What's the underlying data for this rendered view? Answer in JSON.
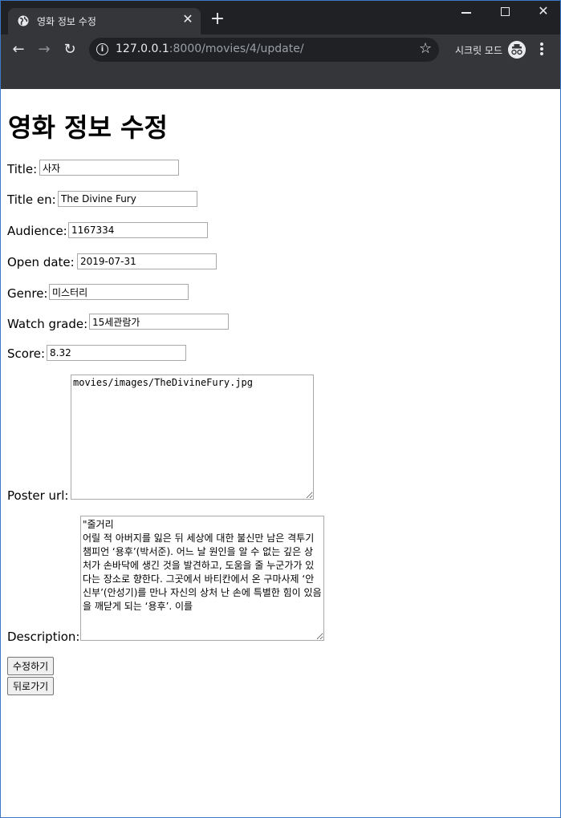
{
  "browser": {
    "tab_title": "영화 정보 수정",
    "url_host": "127.0.0.1",
    "url_rest": ":8000/movies/4/update/",
    "incognito_label": "시크릿 모드"
  },
  "page": {
    "heading": "영화 정보 수정",
    "fields": {
      "title": {
        "label": "Title:",
        "value": "사자"
      },
      "title_en": {
        "label": "Title en:",
        "value": "The Divine Fury"
      },
      "audience": {
        "label": "Audience:",
        "value": "1167334"
      },
      "open_date": {
        "label": "Open date:",
        "value": "2019-07-31"
      },
      "genre": {
        "label": "Genre:",
        "value": "미스터리"
      },
      "watch_grade": {
        "label": "Watch grade:",
        "value": "15세관람가"
      },
      "score": {
        "label": "Score:",
        "value": "8.32"
      },
      "poster_url": {
        "label": "Poster url:",
        "value": "movies/images/TheDivineFury.jpg"
      },
      "description": {
        "label": "Description:",
        "value": "\"줄거리\n어릴 적 아버지를 잃은 뒤 세상에 대한 불신만 남은 격투기 챔피언 ‘용후’(박서준). 어느 날 원인을 알 수 없는 깊은 상처가 손바닥에 생긴 것을 발견하고, 도움을 줄 누군가가 있다는 장소로 향한다. 그곳에서 바티칸에서 온 구마사제 ‘안신부’(안성기)를 만나 자신의 상처 난 손에 특별한 힘이 있음을 깨닫게 되는 ‘용후’. 이를"
      }
    },
    "buttons": {
      "submit": "수정하기",
      "back": "뒤로가기"
    }
  }
}
